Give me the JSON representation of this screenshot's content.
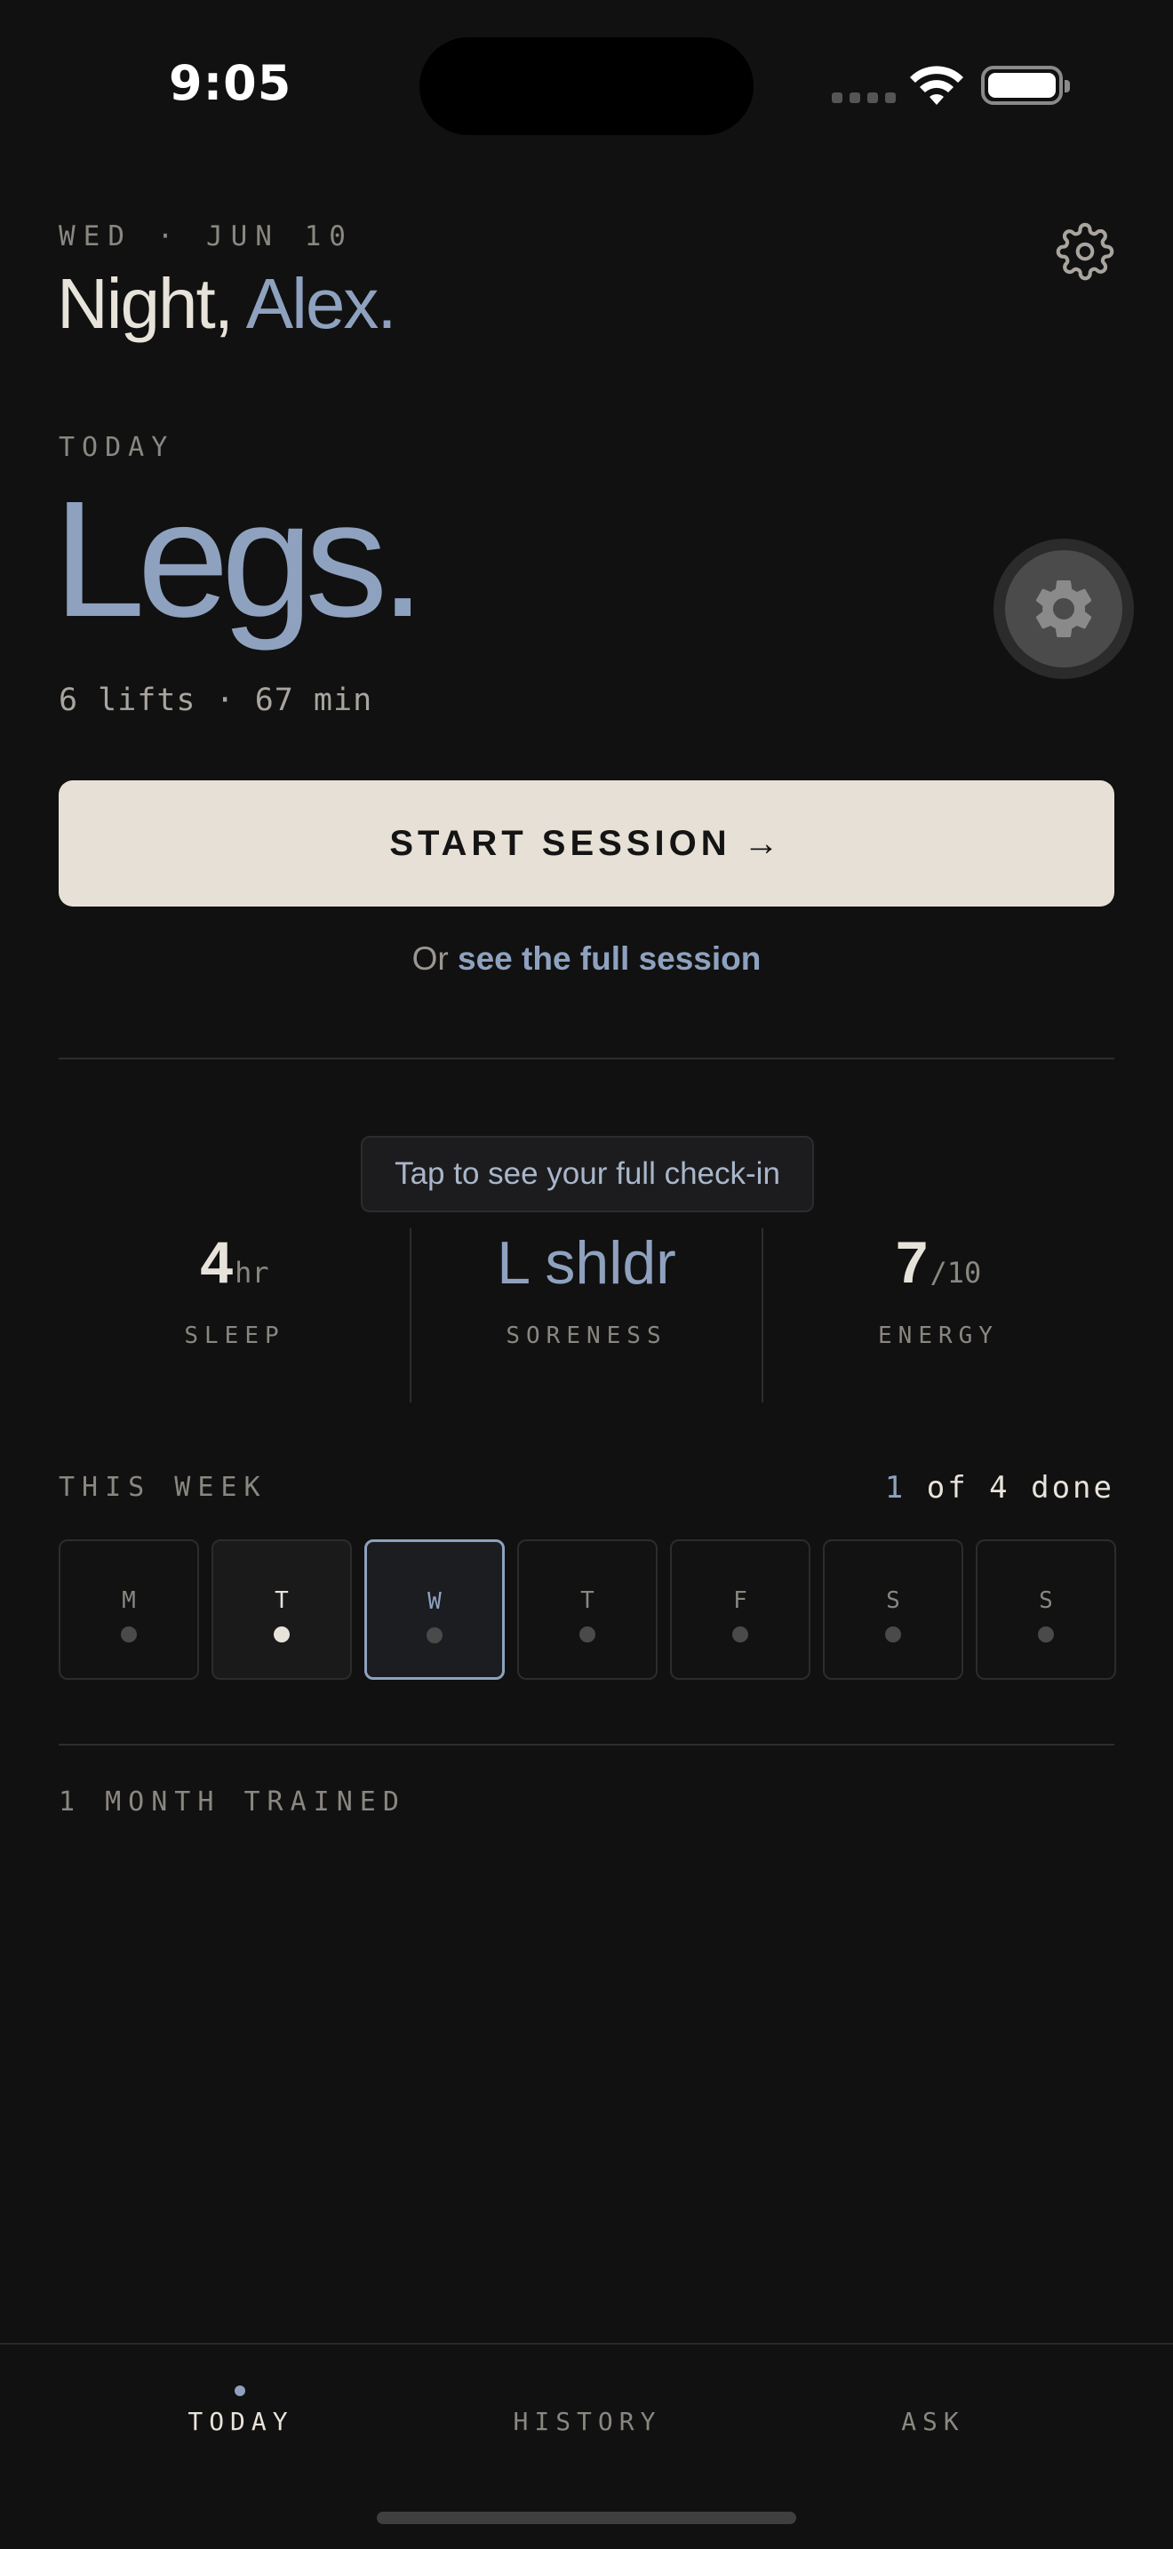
{
  "status": {
    "time": "9:05"
  },
  "header": {
    "date": "WED · JUN 10",
    "greeting_prefix": "Night,",
    "greeting_name": "Alex."
  },
  "today": {
    "label": "TODAY",
    "workout": "Legs.",
    "meta": "6 lifts · 67 min",
    "start_label": "START SESSION",
    "start_arrow": "→",
    "link_prefix": "Or",
    "link_text": "see the full session"
  },
  "checkin": {
    "tooltip": "Tap to see your full check-in",
    "sleep": {
      "value": "4",
      "unit": "hr",
      "label": "SLEEP"
    },
    "soreness": {
      "value": "L shldr",
      "label": "SORENESS"
    },
    "energy": {
      "value": "7",
      "unit": "/10",
      "label": "ENERGY"
    }
  },
  "week": {
    "label": "THIS WEEK",
    "done_count": "1",
    "done_suffix": "of 4 done",
    "days": [
      {
        "letter": "M",
        "state": "rest"
      },
      {
        "letter": "T",
        "state": "done"
      },
      {
        "letter": "W",
        "state": "current"
      },
      {
        "letter": "T",
        "state": "rest"
      },
      {
        "letter": "F",
        "state": "rest"
      },
      {
        "letter": "S",
        "state": "rest"
      },
      {
        "letter": "S",
        "state": "rest"
      }
    ]
  },
  "trained": "1 MONTH TRAINED",
  "tabs": {
    "today": "TODAY",
    "history": "HISTORY",
    "ask": "ASK"
  },
  "icons": {
    "settings": "gear-icon",
    "fab": "gear-icon",
    "wifi": "wifi-icon",
    "battery": "battery-icon"
  },
  "colors": {
    "accent": "#8ea2bf",
    "background": "#111111",
    "button": "#e6e0d6",
    "text": "#e8e3da"
  }
}
